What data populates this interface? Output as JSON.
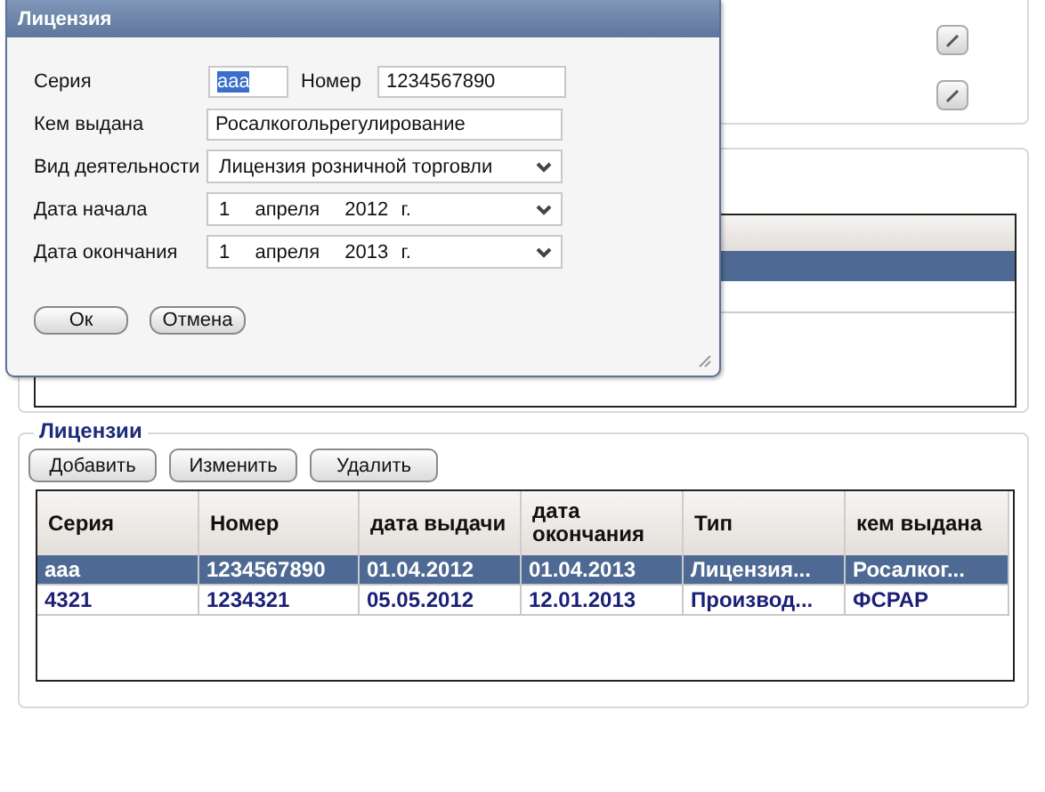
{
  "dialog": {
    "title": "Лицензия",
    "fields": [
      {
        "kind": "pair",
        "label": "Серия",
        "value": "aaa",
        "value_selected": true,
        "label2": "Номер",
        "value2": "1234567890"
      },
      {
        "kind": "text",
        "label": "Кем выдана",
        "value": "Росалкогольрегулирование"
      },
      {
        "kind": "select",
        "label": "Вид деятельности",
        "value": "Лицензия розничной торговли"
      },
      {
        "kind": "date",
        "label": "Дата начала",
        "day": "1",
        "month": "апреля",
        "year": "2012 г."
      },
      {
        "kind": "date",
        "label": "Дата окончания",
        "day": "1",
        "month": "апреля",
        "year": "2013 г."
      }
    ],
    "buttons": [
      "Ок",
      "Отмена"
    ]
  },
  "licenses": {
    "title": "Лицензии",
    "buttons": [
      "Добавить",
      "Изменить",
      "Удалить"
    ],
    "columns": [
      "Серия",
      "Номер",
      "дата выдачи",
      "дата окончания",
      "Тип",
      "кем выдана"
    ],
    "rows": [
      {
        "selected": true,
        "cells": [
          "aaa",
          "1234567890",
          "01.04.2012",
          "01.04.2013",
          "Лицензия...",
          "Росалког..."
        ]
      },
      {
        "selected": false,
        "cells": [
          "4321",
          "1234321",
          "05.05.2012",
          "12.01.2013",
          "Производ...",
          "ФСРАР"
        ]
      }
    ]
  }
}
